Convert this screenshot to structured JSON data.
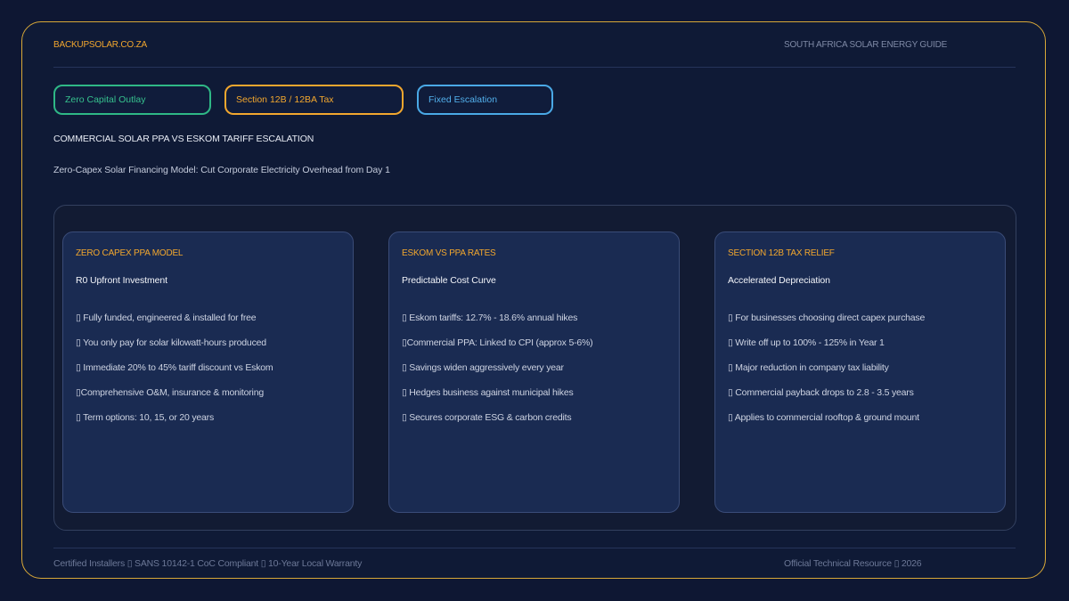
{
  "header": {
    "brand": "BACKUPSOLAR.CO.ZA",
    "guide": "SOUTH AFRICA SOLAR ENERGY GUIDE"
  },
  "pills": [
    {
      "label": "Zero Capital Outlay",
      "color": "#36c18e"
    },
    {
      "label": "Section 12B / 12BA Tax",
      "color": "#f2a72e"
    },
    {
      "label": "Fixed Escalation",
      "color": "#52b0ec"
    }
  ],
  "title": "COMMERCIAL SOLAR PPA VS ESKOM TARIFF ESCALATION",
  "subtitle": "Zero-Capex Solar Financing Model: Cut Corporate Electricity Overhead from Day 1",
  "cards": [
    {
      "category": "ZERO CAPEX PPA MODEL",
      "heading": "R0 Upfront Investment",
      "items": [
        "Fully funded, engineered & installed for free",
        "You only pay for solar kilowatt-hours produced",
        "Immediate 20% to 45% tariff discount vs Eskom",
        "Comprehensive O&M, insurance & monitoring",
        "Term options: 10, 15, or 20 years"
      ]
    },
    {
      "category": "ESKOM VS PPA RATES",
      "heading": "Predictable Cost Curve",
      "items": [
        "Eskom tariffs: 12.7% - 18.6% annual hikes",
        "Commercial PPA: Linked to CPI (approx 5-6%)",
        "Savings widen aggressively every year",
        "Hedges business against municipal hikes",
        "Secures corporate ESG & carbon credits"
      ]
    },
    {
      "category": "SECTION 12B TAX RELIEF",
      "heading": "Accelerated Depreciation",
      "items": [
        "For businesses choosing direct capex purchase",
        "Write off up to 100% - 125% in Year 1",
        "Major reduction in company tax liability",
        "Commercial payback drops to 2.8 - 3.5 years",
        "Applies to commercial rooftop & ground mount"
      ]
    }
  ],
  "footer": {
    "left": "Certified Installers ▯ SANS 10142-1 CoC Compliant ▯ 10-Year Local Warranty",
    "right": "Official Technical Resource ▯ 2026"
  },
  "bullet": "▯",
  "colors": {
    "accent": "#f2a72e",
    "green": "#36c18e",
    "blue": "#52b0ec",
    "frame": "#d8a838"
  }
}
